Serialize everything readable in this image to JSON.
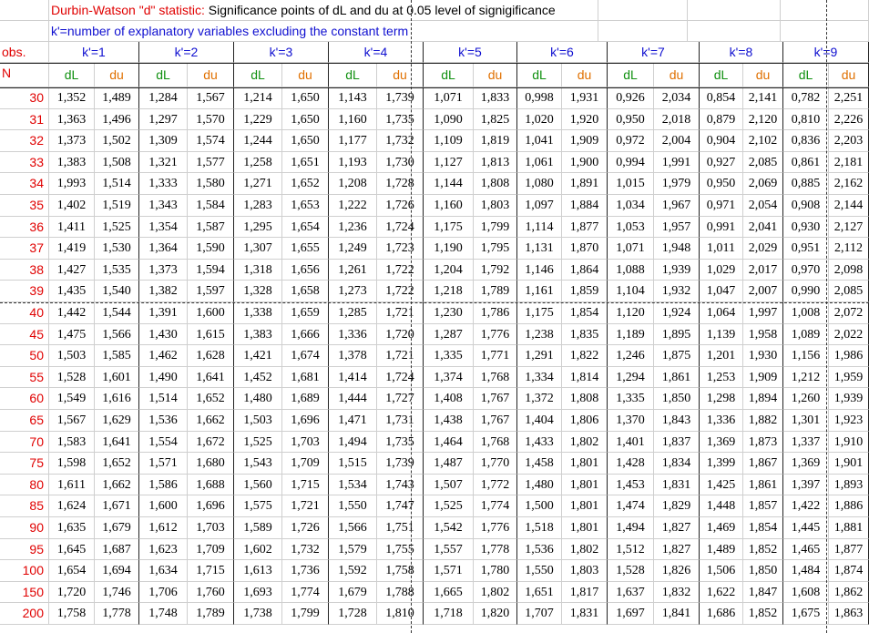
{
  "title": {
    "label_red": "Durbin-Watson \"d\" statistic:",
    "label_black": " Significance points of dL and du at 0.05 level of signigificance",
    "subtitle": "k'=number of explanatory variables excluding the constant term"
  },
  "header": {
    "obs": "obs.",
    "n": "N",
    "k_labels": [
      "k'=1",
      "k'=2",
      "k'=3",
      "k'=4",
      "k'=5",
      "k'=6",
      "k'=7",
      "k'=8",
      "k'=9"
    ],
    "dl": "dL",
    "du": "du"
  },
  "colors": {
    "n_text": "#e00000",
    "k_text": "#1010d0",
    "dl_text": "#109010",
    "du_text": "#e07000"
  },
  "table": {
    "rows": [
      {
        "n": "30",
        "v": [
          "1,352",
          "1,489",
          "1,284",
          "1,567",
          "1,214",
          "1,650",
          "1,143",
          "1,739",
          "1,071",
          "1,833",
          "0,998",
          "1,931",
          "0,926",
          "2,034",
          "0,854",
          "2,141",
          "0,782",
          "2,251"
        ]
      },
      {
        "n": "31",
        "v": [
          "1,363",
          "1,496",
          "1,297",
          "1,570",
          "1,229",
          "1,650",
          "1,160",
          "1,735",
          "1,090",
          "1,825",
          "1,020",
          "1,920",
          "0,950",
          "2,018",
          "0,879",
          "2,120",
          "0,810",
          "2,226"
        ]
      },
      {
        "n": "32",
        "v": [
          "1,373",
          "1,502",
          "1,309",
          "1,574",
          "1,244",
          "1,650",
          "1,177",
          "1,732",
          "1,109",
          "1,819",
          "1,041",
          "1,909",
          "0,972",
          "2,004",
          "0,904",
          "2,102",
          "0,836",
          "2,203"
        ]
      },
      {
        "n": "33",
        "v": [
          "1,383",
          "1,508",
          "1,321",
          "1,577",
          "1,258",
          "1,651",
          "1,193",
          "1,730",
          "1,127",
          "1,813",
          "1,061",
          "1,900",
          "0,994",
          "1,991",
          "0,927",
          "2,085",
          "0,861",
          "2,181"
        ]
      },
      {
        "n": "34",
        "v": [
          "1,993",
          "1,514",
          "1,333",
          "1,580",
          "1,271",
          "1,652",
          "1,208",
          "1,728",
          "1,144",
          "1,808",
          "1,080",
          "1,891",
          "1,015",
          "1,979",
          "0,950",
          "2,069",
          "0,885",
          "2,162"
        ]
      },
      {
        "n": "35",
        "v": [
          "1,402",
          "1,519",
          "1,343",
          "1,584",
          "1,283",
          "1,653",
          "1,222",
          "1,726",
          "1,160",
          "1,803",
          "1,097",
          "1,884",
          "1,034",
          "1,967",
          "0,971",
          "2,054",
          "0,908",
          "2,144"
        ]
      },
      {
        "n": "36",
        "v": [
          "1,411",
          "1,525",
          "1,354",
          "1,587",
          "1,295",
          "1,654",
          "1,236",
          "1,724",
          "1,175",
          "1,799",
          "1,114",
          "1,877",
          "1,053",
          "1,957",
          "0,991",
          "2,041",
          "0,930",
          "2,127"
        ]
      },
      {
        "n": "37",
        "v": [
          "1,419",
          "1,530",
          "1,364",
          "1,590",
          "1,307",
          "1,655",
          "1,249",
          "1,723",
          "1,190",
          "1,795",
          "1,131",
          "1,870",
          "1,071",
          "1,948",
          "1,011",
          "2,029",
          "0,951",
          "2,112"
        ]
      },
      {
        "n": "38",
        "v": [
          "1,427",
          "1,535",
          "1,373",
          "1,594",
          "1,318",
          "1,656",
          "1,261",
          "1,722",
          "1,204",
          "1,792",
          "1,146",
          "1,864",
          "1,088",
          "1,939",
          "1,029",
          "2,017",
          "0,970",
          "2,098"
        ]
      },
      {
        "n": "39",
        "v": [
          "1,435",
          "1,540",
          "1,382",
          "1,597",
          "1,328",
          "1,658",
          "1,273",
          "1,722",
          "1,218",
          "1,789",
          "1,161",
          "1,859",
          "1,104",
          "1,932",
          "1,047",
          "2,007",
          "0,990",
          "2,085"
        ]
      },
      {
        "n": "40",
        "v": [
          "1,442",
          "1,544",
          "1,391",
          "1,600",
          "1,338",
          "1,659",
          "1,285",
          "1,721",
          "1,230",
          "1,786",
          "1,175",
          "1,854",
          "1,120",
          "1,924",
          "1,064",
          "1,997",
          "1,008",
          "2,072"
        ]
      },
      {
        "n": "45",
        "v": [
          "1,475",
          "1,566",
          "1,430",
          "1,615",
          "1,383",
          "1,666",
          "1,336",
          "1,720",
          "1,287",
          "1,776",
          "1,238",
          "1,835",
          "1,189",
          "1,895",
          "1,139",
          "1,958",
          "1,089",
          "2,022"
        ]
      },
      {
        "n": "50",
        "v": [
          "1,503",
          "1,585",
          "1,462",
          "1,628",
          "1,421",
          "1,674",
          "1,378",
          "1,721",
          "1,335",
          "1,771",
          "1,291",
          "1,822",
          "1,246",
          "1,875",
          "1,201",
          "1,930",
          "1,156",
          "1,986"
        ]
      },
      {
        "n": "55",
        "v": [
          "1,528",
          "1,601",
          "1,490",
          "1,641",
          "1,452",
          "1,681",
          "1,414",
          "1,724",
          "1,374",
          "1,768",
          "1,334",
          "1,814",
          "1,294",
          "1,861",
          "1,253",
          "1,909",
          "1,212",
          "1,959"
        ]
      },
      {
        "n": "60",
        "v": [
          "1,549",
          "1,616",
          "1,514",
          "1,652",
          "1,480",
          "1,689",
          "1,444",
          "1,727",
          "1,408",
          "1,767",
          "1,372",
          "1,808",
          "1,335",
          "1,850",
          "1,298",
          "1,894",
          "1,260",
          "1,939"
        ]
      },
      {
        "n": "65",
        "v": [
          "1,567",
          "1,629",
          "1,536",
          "1,662",
          "1,503",
          "1,696",
          "1,471",
          "1,731",
          "1,438",
          "1,767",
          "1,404",
          "1,806",
          "1,370",
          "1,843",
          "1,336",
          "1,882",
          "1,301",
          "1,923"
        ]
      },
      {
        "n": "70",
        "v": [
          "1,583",
          "1,641",
          "1,554",
          "1,672",
          "1,525",
          "1,703",
          "1,494",
          "1,735",
          "1,464",
          "1,768",
          "1,433",
          "1,802",
          "1,401",
          "1,837",
          "1,369",
          "1,873",
          "1,337",
          "1,910"
        ]
      },
      {
        "n": "75",
        "v": [
          "1,598",
          "1,652",
          "1,571",
          "1,680",
          "1,543",
          "1,709",
          "1,515",
          "1,739",
          "1,487",
          "1,770",
          "1,458",
          "1,801",
          "1,428",
          "1,834",
          "1,399",
          "1,867",
          "1,369",
          "1,901"
        ]
      },
      {
        "n": "80",
        "v": [
          "1,611",
          "1,662",
          "1,586",
          "1,688",
          "1,560",
          "1,715",
          "1,534",
          "1,743",
          "1,507",
          "1,772",
          "1,480",
          "1,801",
          "1,453",
          "1,831",
          "1,425",
          "1,861",
          "1,397",
          "1,893"
        ]
      },
      {
        "n": "85",
        "v": [
          "1,624",
          "1,671",
          "1,600",
          "1,696",
          "1,575",
          "1,721",
          "1,550",
          "1,747",
          "1,525",
          "1,774",
          "1,500",
          "1,801",
          "1,474",
          "1,829",
          "1,448",
          "1,857",
          "1,422",
          "1,886"
        ]
      },
      {
        "n": "90",
        "v": [
          "1,635",
          "1,679",
          "1,612",
          "1,703",
          "1,589",
          "1,726",
          "1,566",
          "1,751",
          "1,542",
          "1,776",
          "1,518",
          "1,801",
          "1,494",
          "1,827",
          "1,469",
          "1,854",
          "1,445",
          "1,881"
        ]
      },
      {
        "n": "95",
        "v": [
          "1,645",
          "1,687",
          "1,623",
          "1,709",
          "1,602",
          "1,732",
          "1,579",
          "1,755",
          "1,557",
          "1,778",
          "1,536",
          "1,802",
          "1,512",
          "1,827",
          "1,489",
          "1,852",
          "1,465",
          "1,877"
        ]
      },
      {
        "n": "100",
        "v": [
          "1,654",
          "1,694",
          "1,634",
          "1,715",
          "1,613",
          "1,736",
          "1,592",
          "1,758",
          "1,571",
          "1,780",
          "1,550",
          "1,803",
          "1,528",
          "1,826",
          "1,506",
          "1,850",
          "1,484",
          "1,874"
        ]
      },
      {
        "n": "150",
        "v": [
          "1,720",
          "1,746",
          "1,706",
          "1,760",
          "1,693",
          "1,774",
          "1,679",
          "1,788",
          "1,665",
          "1,802",
          "1,651",
          "1,817",
          "1,637",
          "1,832",
          "1,622",
          "1,847",
          "1,608",
          "1,862"
        ]
      },
      {
        "n": "200",
        "v": [
          "1,758",
          "1,778",
          "1,748",
          "1,789",
          "1,738",
          "1,799",
          "1,728",
          "1,810",
          "1,718",
          "1,820",
          "1,707",
          "1,831",
          "1,697",
          "1,841",
          "1,686",
          "1,852",
          "1,675",
          "1,863"
        ]
      }
    ]
  }
}
